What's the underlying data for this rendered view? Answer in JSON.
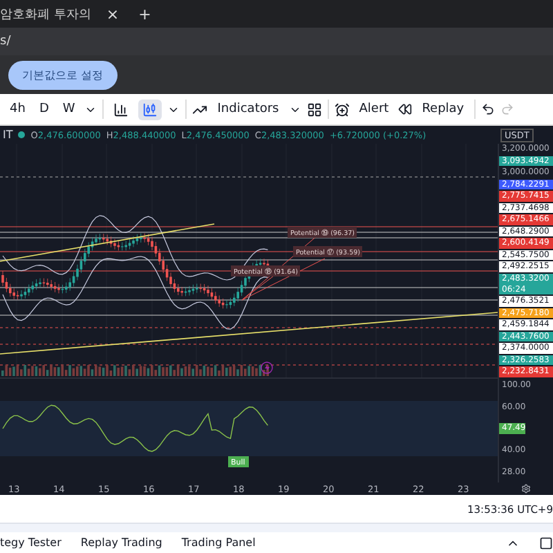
{
  "browser": {
    "tab_title": "암호화폐 투자의",
    "tab_close": "×",
    "new_tab": "+",
    "address": "s/"
  },
  "banner": {
    "button": "기본값으로 설정"
  },
  "toolbar": {
    "intervals": [
      {
        "label": "4h",
        "selected": false
      },
      {
        "label": "D",
        "selected": false
      },
      {
        "label": "W",
        "selected": false
      }
    ],
    "chart_types": [
      {
        "kind": "bars",
        "selected": false
      },
      {
        "kind": "candles",
        "selected": true
      }
    ],
    "indicators": "Indicators",
    "alert": "Alert",
    "replay": "Replay"
  },
  "legend": {
    "symbol": "IT",
    "values": [
      {
        "label": "O",
        "value": "2,476.600000"
      },
      {
        "label": "H",
        "value": "2,488.440000"
      },
      {
        "label": "L",
        "value": "2,476.450000"
      },
      {
        "label": "C",
        "value": "2,483.320000"
      }
    ],
    "change": "+6.720000 (+0.27%)"
  },
  "price_axis": {
    "currency": "USDT",
    "labels": [
      {
        "text": "3,200.0000",
        "kind": "plain"
      },
      {
        "text": "3,093.4942",
        "kind": "badge",
        "color": "#26a69a"
      },
      {
        "text": "3,000.0000",
        "kind": "plain"
      },
      {
        "text": "2,784.2291",
        "kind": "badge",
        "color": "#3d5afe"
      },
      {
        "text": "2,775.7415",
        "kind": "badge",
        "color": "#e53935"
      },
      {
        "text": "2,737.4698",
        "kind": "badge",
        "color": "#ffffff"
      },
      {
        "text": "2,675.1466",
        "kind": "badge",
        "color": "#e53935"
      },
      {
        "text": "2,648.2900",
        "kind": "badge",
        "color": "#ffffff"
      },
      {
        "text": "2,600.4149",
        "kind": "badge",
        "color": "#e53935"
      },
      {
        "text": "2,545.7500",
        "kind": "badge",
        "color": "#ffffff"
      },
      {
        "text": "2,492.2515",
        "kind": "badge",
        "color": "#ffffff"
      },
      {
        "text": "2,483.3200",
        "kind": "badge",
        "color": "#26a69a",
        "sub": "06:24"
      },
      {
        "text": "2,476.3521",
        "kind": "badge",
        "color": "#ffffff"
      },
      {
        "text": "2,475.7180",
        "kind": "badge",
        "color": "#f7a21b"
      },
      {
        "text": "2,459.1844",
        "kind": "badge",
        "color": "#ffffff"
      },
      {
        "text": "2,443.7600",
        "kind": "badge",
        "color": "#26a69a"
      },
      {
        "text": "2,374.0000",
        "kind": "badge",
        "color": "#ffffff"
      },
      {
        "text": "2,326.2583",
        "kind": "badge",
        "color": "#26a69a"
      },
      {
        "text": "2,232.8431",
        "kind": "badge",
        "color": "#e53935"
      }
    ]
  },
  "potential_labels": [
    "Potential ⑲ (96.37)",
    "Potential ⑰ (93.59)",
    "Potential ⑱ (91.64)"
  ],
  "rsi": {
    "signal": "Bull",
    "labels": [
      {
        "text": "100.00",
        "kind": "plain"
      },
      {
        "text": "60.00",
        "kind": "plain"
      },
      {
        "text": "47.49",
        "kind": "badge",
        "color": "#4caf50"
      },
      {
        "text": "40.00",
        "kind": "plain"
      },
      {
        "text": "28.00",
        "kind": "plain"
      }
    ]
  },
  "time_axis": [
    "13",
    "14",
    "15",
    "16",
    "17",
    "18",
    "19",
    "20",
    "21",
    "22",
    "23"
  ],
  "status": {
    "time": "13:53:36 UTC+9"
  },
  "bottom_tabs": [
    "tegy Tester",
    "Replay Trading",
    "Trading Panel"
  ]
}
